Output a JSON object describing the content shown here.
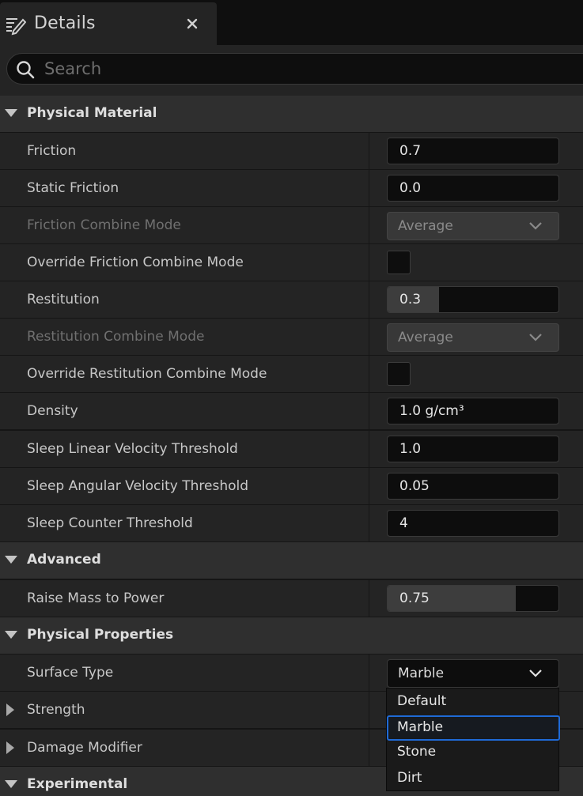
{
  "tab": {
    "title": "Details",
    "close_icon": "close-icon",
    "edit_icon": "pencil-icon"
  },
  "search": {
    "placeholder": "Search",
    "value": ""
  },
  "categories": {
    "physical_material": "Physical Material",
    "advanced": "Advanced",
    "physical_properties": "Physical Properties",
    "experimental": "Experimental"
  },
  "rows": {
    "friction": {
      "label": "Friction",
      "value": "0.7"
    },
    "static_friction": {
      "label": "Static Friction",
      "value": "0.0"
    },
    "friction_combine_mode": {
      "label": "Friction Combine Mode",
      "value": "Average"
    },
    "override_friction_combine_mode": {
      "label": "Override Friction Combine Mode",
      "checked": false
    },
    "restitution": {
      "label": "Restitution",
      "value": "0.3",
      "fill_fraction": 0.3
    },
    "restitution_combine_mode": {
      "label": "Restitution Combine Mode",
      "value": "Average"
    },
    "override_restitution_combine_mode": {
      "label": "Override Restitution Combine Mode",
      "checked": false
    },
    "density": {
      "label": "Density",
      "value": "1.0 g/cm³"
    },
    "sleep_linear": {
      "label": "Sleep Linear Velocity Threshold",
      "value": "1.0"
    },
    "sleep_angular": {
      "label": "Sleep Angular Velocity Threshold",
      "value": "0.05"
    },
    "sleep_counter": {
      "label": "Sleep Counter Threshold",
      "value": "4"
    },
    "raise_mass": {
      "label": "Raise Mass to Power",
      "value": "0.75",
      "fill_fraction": 0.75
    },
    "surface_type": {
      "label": "Surface Type",
      "value": "Marble"
    },
    "strength": {
      "label": "Strength"
    },
    "damage_modifier": {
      "label": "Damage Modifier"
    }
  },
  "surface_dropdown": {
    "options": [
      "Default",
      "Marble",
      "Stone",
      "Dirt"
    ],
    "selected": "Marble"
  },
  "colors": {
    "selection": "#1f6ad6",
    "panel": "#242424",
    "header": "#2f2f2f"
  }
}
